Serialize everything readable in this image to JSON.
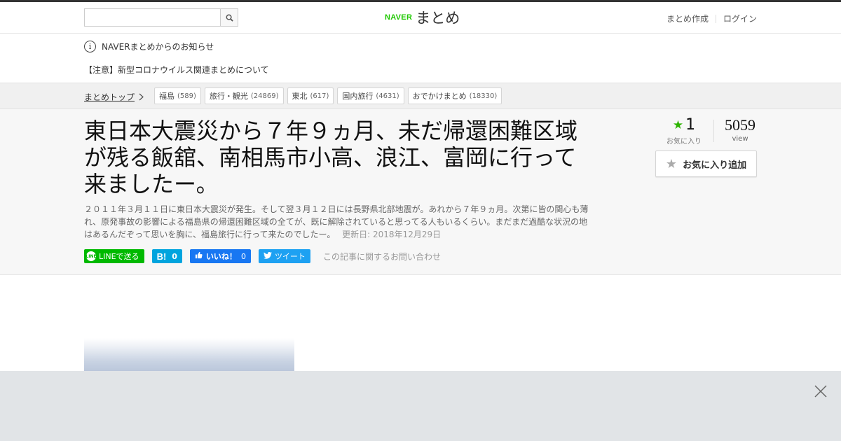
{
  "header": {
    "search_placeholder": "",
    "logo_naver": "NAVER",
    "logo_matome": "まとめ",
    "links": [
      "まとめ作成",
      "ログイン"
    ]
  },
  "notice": {
    "title": "NAVERまとめからのお知らせ",
    "link": "【注意】新型コロナウイルス関連まとめについて"
  },
  "breadcrumb": {
    "top": "まとめトップ",
    "tags": [
      {
        "label": "福島",
        "count": "(589)"
      },
      {
        "label": "旅行・観光",
        "count": "(24869)"
      },
      {
        "label": "東北",
        "count": "(617)"
      },
      {
        "label": "国内旅行",
        "count": "(4631)"
      },
      {
        "label": "おでかけまとめ",
        "count": "(18330)"
      }
    ]
  },
  "article": {
    "title": "東日本大震災から７年９ヵ月、未だ帰還困難区域が残る飯舘、南相馬市小高、浪江、富岡に行って来ましたー。",
    "description": "２０１１年３月１１日に東日本大震災が発生。そして翌３月１２日には長野県北部地震が。あれから７年９ヵ月。次第に皆の関心も薄れ、原発事故の影響による福島県の帰還困難区域の全てが、既に解除されていると思ってる人もいるくらい。まだまだ過酷な状況の地はあるんだぞって思いを胸に、福島旅行に行って来たのでしたー。",
    "updated": "更新日: 2018年12月29日"
  },
  "stats": {
    "favorites": "1",
    "favorites_label": "お気に入り",
    "views": "5059",
    "views_label": "view",
    "fav_button": "お気に入り追加"
  },
  "share": {
    "line": "LINEで送る",
    "line_icon_text": "LINE",
    "hatena_icon": "B!",
    "hatena_count": "0",
    "facebook": "いいね！",
    "facebook_count": "0",
    "twitter": "ツイート",
    "inquiry": "この記事に関するお問い合わせ"
  },
  "colors": {
    "naver_green": "#1ec800",
    "line_green": "#00b900",
    "hatena_blue": "#00a4de",
    "facebook_blue": "#1877f2",
    "twitter_blue": "#1da1f2",
    "star_green": "#2db400"
  },
  "icons": {
    "search": "search-icon",
    "info": "info-icon",
    "chevron": "chevron-right-icon",
    "star": "star-icon",
    "close": "close-icon"
  }
}
